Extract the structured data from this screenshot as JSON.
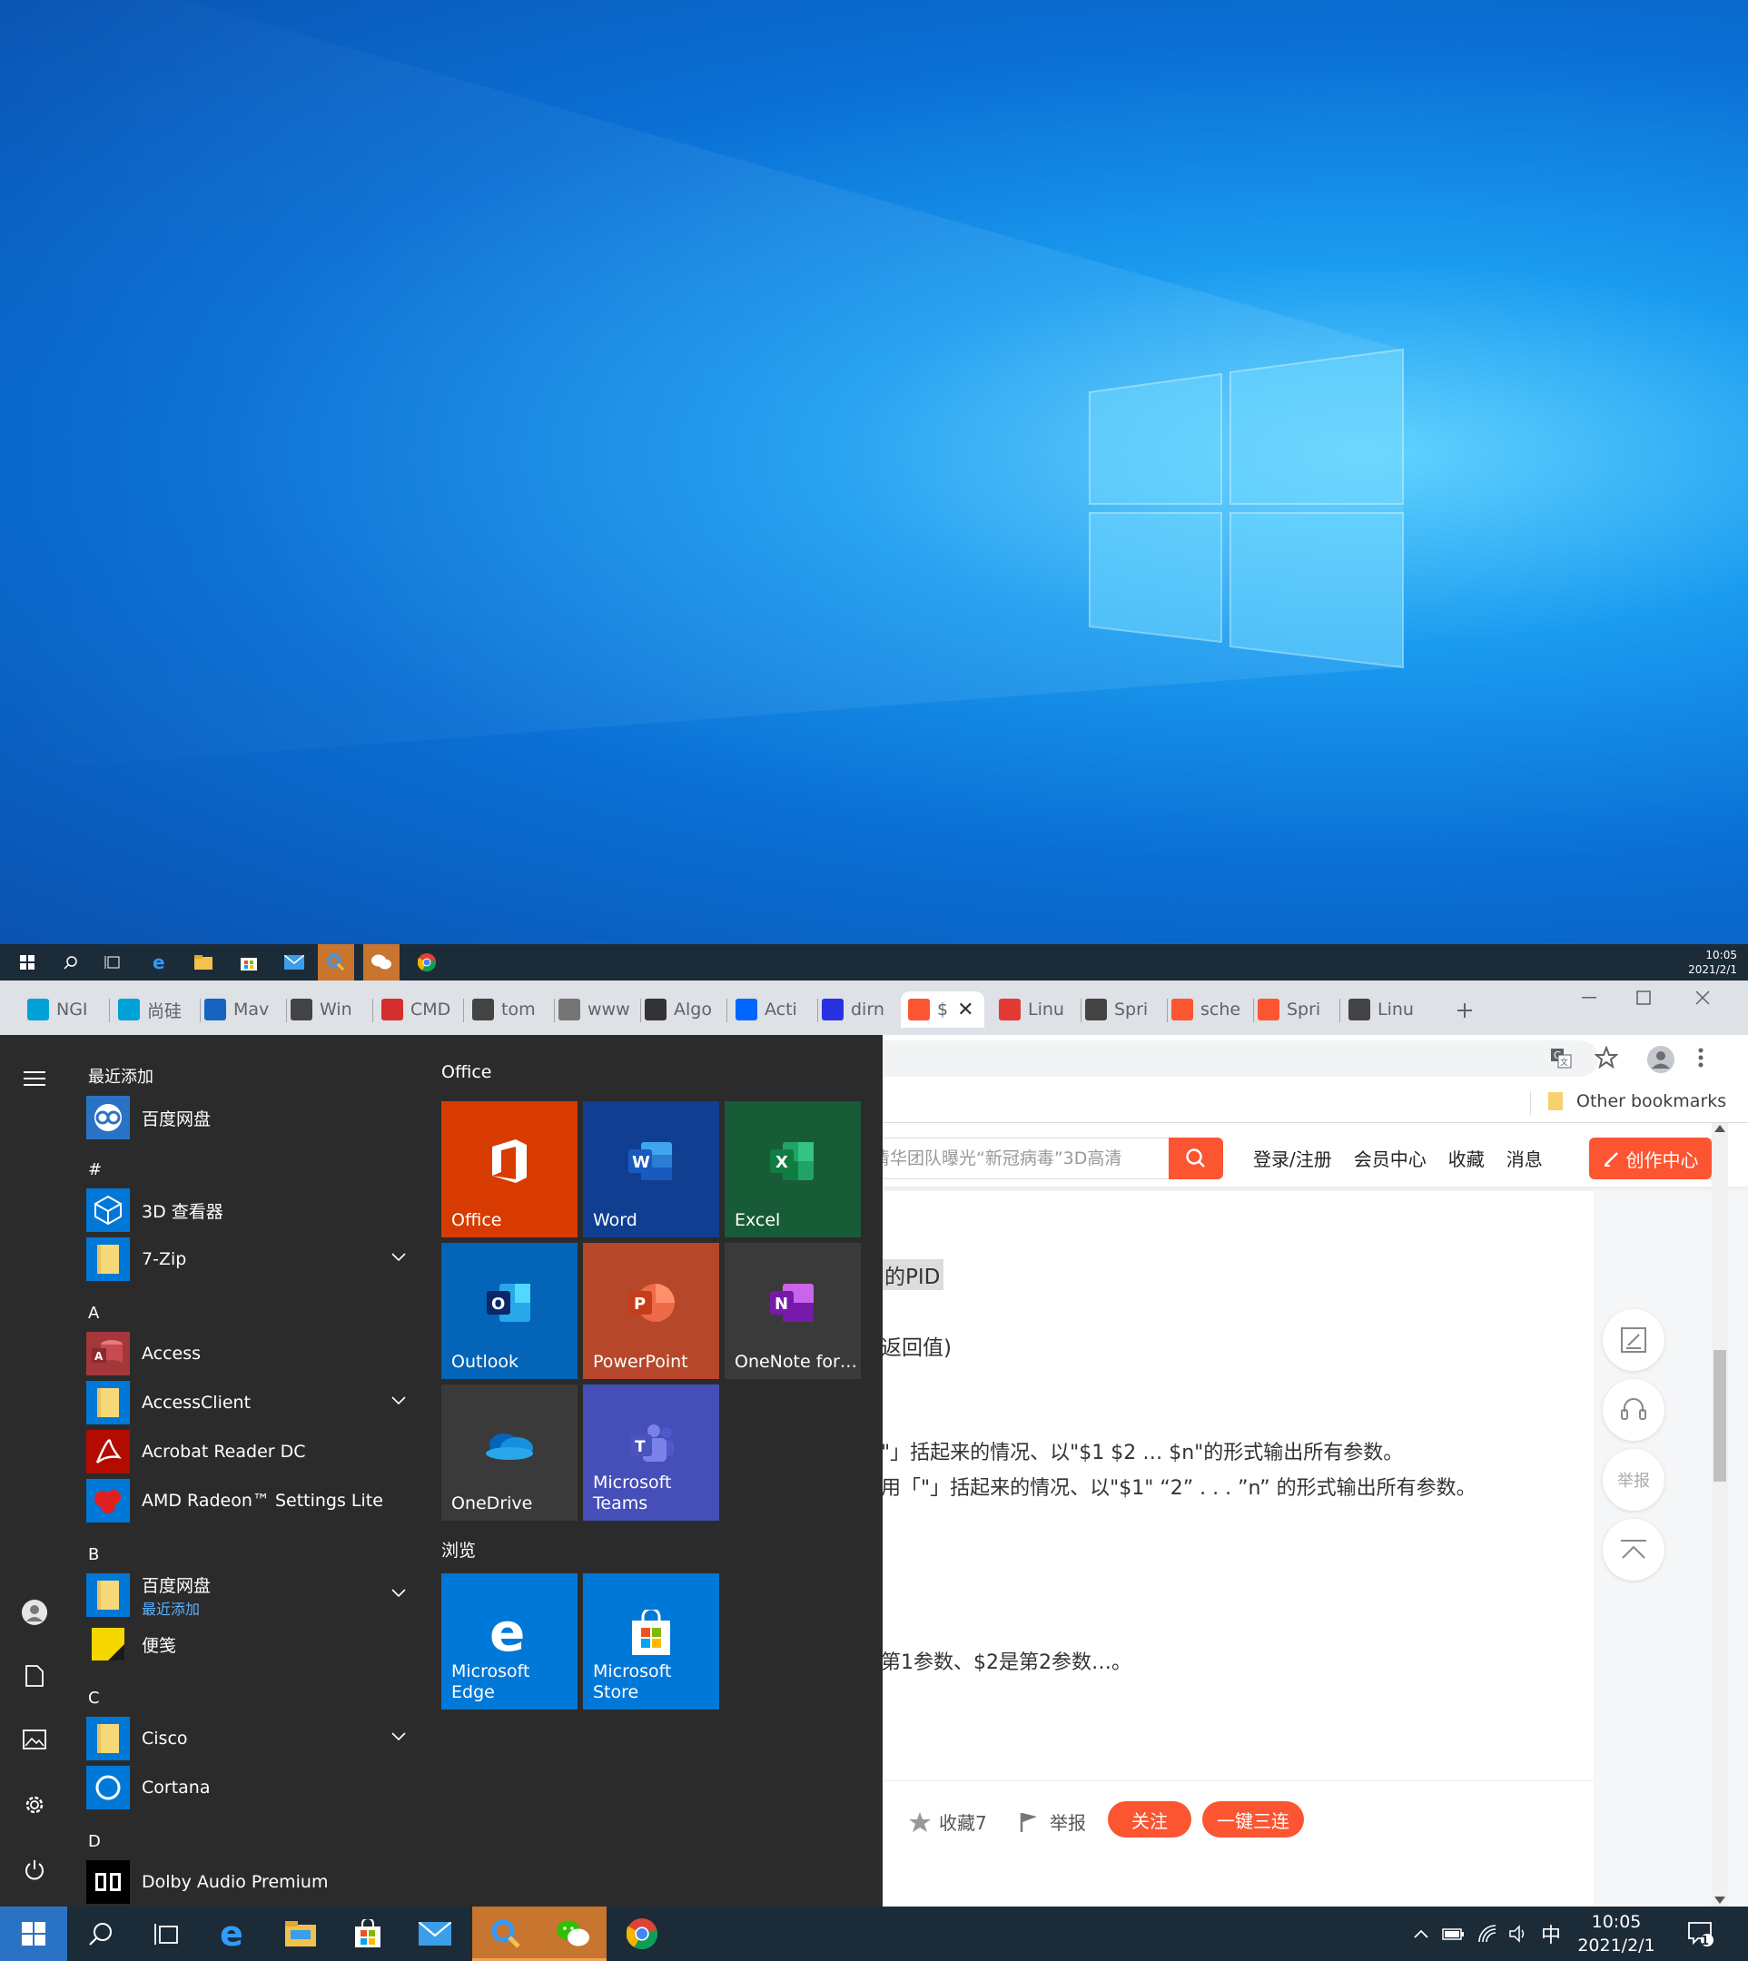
{
  "top_taskbar": {
    "time": "10:05",
    "date": "2021/2/1"
  },
  "browser": {
    "tabs": [
      {
        "label": "NGI",
        "icon": "bilibili-icon",
        "color": "#00a1d6"
      },
      {
        "label": "尚硅",
        "icon": "bilibili-icon",
        "color": "#00a1d6"
      },
      {
        "label": "Mav",
        "icon": "mvn-icon",
        "color": "#1565c0"
      },
      {
        "label": "Win",
        "icon": "pen-icon",
        "color": "#444444"
      },
      {
        "label": "CMD",
        "icon": "cube-icon",
        "color": "#d32f2f"
      },
      {
        "label": "tom",
        "icon": "pen-icon",
        "color": "#444444"
      },
      {
        "label": "www",
        "icon": "video-icon",
        "color": "#757575"
      },
      {
        "label": "Algo",
        "icon": "tiger-icon",
        "color": "#333333"
      },
      {
        "label": "Acti",
        "icon": "zhihu-icon",
        "color": "#0066ff"
      },
      {
        "label": "dirn",
        "icon": "baidu-icon",
        "color": "#2932e1"
      },
      {
        "label": "$",
        "icon": "csdn-icon",
        "color": "#fc5531",
        "active": true
      },
      {
        "label": "Linu",
        "icon": "51cto-icon",
        "color": "#e53935"
      },
      {
        "label": "Spri",
        "icon": "pen-icon",
        "color": "#444444"
      },
      {
        "label": "sche",
        "icon": "csdn-icon",
        "color": "#fc5531"
      },
      {
        "label": "Spri",
        "icon": "csdn-icon",
        "color": "#fc5531"
      },
      {
        "label": "Linu",
        "icon": "pen-icon",
        "color": "#444444"
      }
    ],
    "bookmarks": {
      "other": "Other bookmarks"
    },
    "csdn": {
      "search_placeholder": "清华团队曝光“新冠病毒”3D高清",
      "nav": [
        "登录/注册",
        "会员中心",
        "收藏",
        "消息"
      ],
      "create": "创作中心",
      "report": "举报"
    },
    "article": {
      "line1": "的PID",
      "line2": "返回值)",
      "line3": "\"」括起来的情况、以\"$1 $2 … $n\"的形式输出所有参数。",
      "line4": "用「\"」括起来的情况、以\"$1\" “2” . . . ”n” 的形式输出所有参数。",
      "line5": "第1参数、$2是第2参数…。",
      "actions": {
        "fav": "收藏7",
        "report": "举报",
        "follow": "关注",
        "triple": "一键三连"
      }
    }
  },
  "start_menu": {
    "recent_header": "最近添加",
    "recent": [
      {
        "label": "百度网盘",
        "icon": "baidu-netdisk-icon"
      }
    ],
    "groups": [
      {
        "letter": "#",
        "apps": [
          {
            "label": "3D 查看器",
            "icon": "3d-viewer-icon",
            "chevron": false
          },
          {
            "label": "7-Zip",
            "icon": "folder-icon",
            "chevron": true
          }
        ]
      },
      {
        "letter": "A",
        "apps": [
          {
            "label": "Access",
            "icon": "access-icon",
            "chevron": false
          },
          {
            "label": "AccessClient",
            "icon": "folder-icon",
            "chevron": true
          },
          {
            "label": "Acrobat Reader DC",
            "icon": "acrobat-icon",
            "chevron": false
          },
          {
            "label": "AMD Radeon™ Settings Lite",
            "icon": "amd-icon",
            "chevron": false
          }
        ]
      },
      {
        "letter": "B",
        "apps": [
          {
            "label": "百度网盘",
            "sub": "最近添加",
            "icon": "folder-icon",
            "chevron": true
          },
          {
            "label": "便笺",
            "icon": "sticky-notes-icon",
            "chevron": false
          }
        ]
      },
      {
        "letter": "C",
        "apps": [
          {
            "label": "Cisco",
            "icon": "folder-icon",
            "chevron": true
          },
          {
            "label": "Cortana",
            "icon": "cortana-icon",
            "chevron": false
          }
        ]
      },
      {
        "letter": "D",
        "apps": [
          {
            "label": "Dolby Audio Premium",
            "icon": "dolby-icon",
            "chevron": false
          }
        ]
      }
    ],
    "tiles_office_header": "Office",
    "tiles_office": [
      {
        "label": "Office",
        "color": "#d83b01",
        "icon": "office-icon"
      },
      {
        "label": "Word",
        "color": "#103f91",
        "icon": "word-icon"
      },
      {
        "label": "Excel",
        "color": "#185c37",
        "icon": "excel-icon"
      },
      {
        "label": "Outlook",
        "color": "#0364b8",
        "icon": "outlook-icon"
      },
      {
        "label": "PowerPoint",
        "color": "#b7472a",
        "icon": "powerpoint-icon"
      },
      {
        "label": "OneNote for…",
        "color": "#3a3a3a",
        "icon": "onenote-icon"
      },
      {
        "label": "OneDrive",
        "color": "#3a3a3a",
        "icon": "onedrive-icon"
      },
      {
        "label": "Microsoft Teams",
        "color": "#464eb8",
        "icon": "teams-icon"
      }
    ],
    "tiles_browse_header": "浏览",
    "tiles_browse": [
      {
        "label": "Microsoft Edge",
        "color": "#0078d7",
        "icon": "edge-icon"
      },
      {
        "label": "Microsoft Store",
        "color": "#0078d7",
        "icon": "store-icon"
      }
    ]
  },
  "taskbar": {
    "time": "10:05",
    "date": "2021/2/1",
    "ime": "中",
    "notif_count": "1"
  }
}
